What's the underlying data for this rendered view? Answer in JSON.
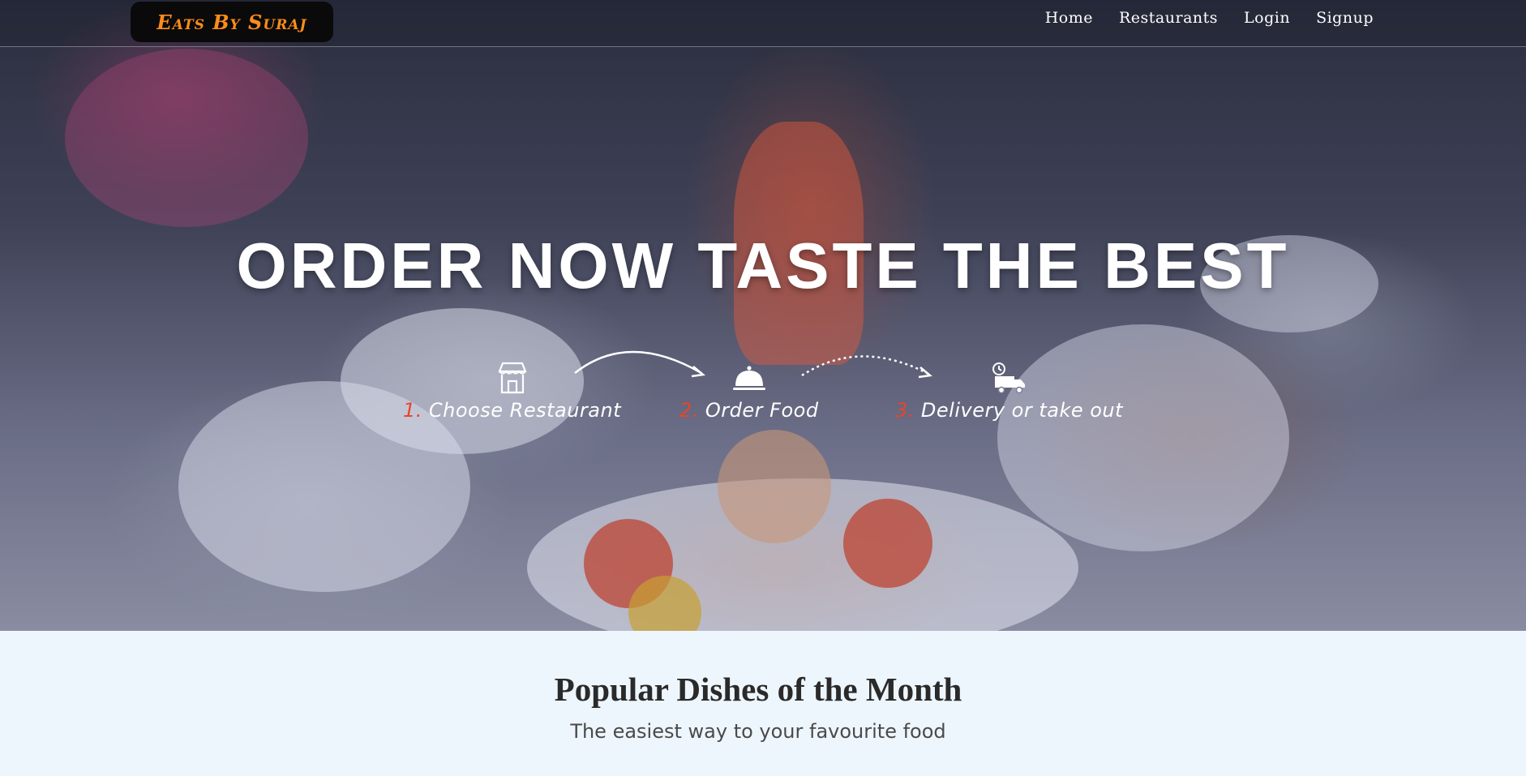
{
  "navbar": {
    "brand": "Eats By Suraj",
    "links": [
      "Home",
      "Restaurants",
      "Login",
      "Signup"
    ]
  },
  "hero": {
    "headline": "ORDER NOW TASTE THE BEST",
    "steps": [
      {
        "num": "1.",
        "label": "Choose Restaurant",
        "icon": "store-icon"
      },
      {
        "num": "2.",
        "label": "Order Food",
        "icon": "cloche-icon"
      },
      {
        "num": "3.",
        "label": "Delivery or take out",
        "icon": "delivery-truck-icon"
      }
    ]
  },
  "section": {
    "title": "Popular Dishes of the Month",
    "subtitle": "The easiest way to your favourite food"
  },
  "colors": {
    "brand_text": "#ff8c1a",
    "brand_bg": "#0a0a0a",
    "step_number": "#e8452c",
    "section_bg": "#eef6fd"
  }
}
